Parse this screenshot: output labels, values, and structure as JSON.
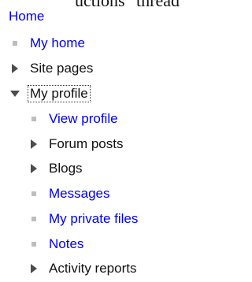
{
  "header_fragment": "uctions\" thread",
  "nav": {
    "home_label": "Home",
    "items": [
      {
        "label": "My home",
        "kind": "link"
      },
      {
        "label": "Site pages",
        "kind": "branch-collapsed"
      },
      {
        "label": "My profile",
        "kind": "branch-expanded",
        "current": true
      },
      {
        "label": "View profile",
        "kind": "link"
      },
      {
        "label": "Forum posts",
        "kind": "branch-collapsed"
      },
      {
        "label": "Blogs",
        "kind": "branch-collapsed"
      },
      {
        "label": "Messages",
        "kind": "link"
      },
      {
        "label": "My private files",
        "kind": "link"
      },
      {
        "label": "Notes",
        "kind": "link"
      },
      {
        "label": "Activity reports",
        "kind": "branch-collapsed"
      }
    ]
  },
  "colors": {
    "link": "#0000ee",
    "text": "#111111",
    "bullet": "#bdbdbd",
    "arrow": "#4c4c4c"
  }
}
